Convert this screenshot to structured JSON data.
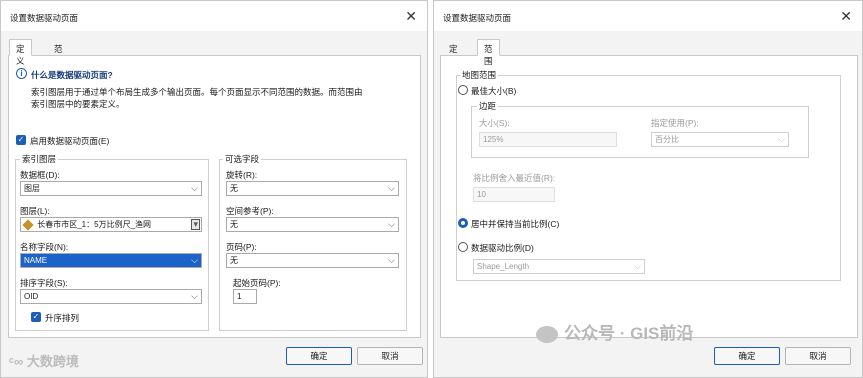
{
  "left_dialog": {
    "title": "设置数据驱动页面",
    "tabs": [
      "定义",
      "范围"
    ],
    "info": {
      "heading": "什么是数据驱动页面?",
      "line1": "索引图层用于通过单个布局生成多个输出页面。每个页面显示不同范围的数据。而范围由",
      "line2": "索引图层中的要素定义。"
    },
    "enable_checkbox_label": "启用数据驱动页面(E)",
    "index_layer_group": {
      "title": "索引图层",
      "data_frame_label": "数据框(D):",
      "data_frame_value": "图层",
      "layer_label": "图层(L):",
      "layer_value": "长春市市区_1：5万比例尺_渔网",
      "name_field_label": "名称字段(N):",
      "name_field_value": "NAME",
      "sort_field_label": "排序字段(S):",
      "sort_field_value": "OID",
      "ascending_label": "升序排列"
    },
    "optional_fields_group": {
      "title": "可选字段",
      "rotation_label": "旋转(R):",
      "rotation_value": "无",
      "spatial_ref_label": "空间参考(P):",
      "spatial_ref_value": "无",
      "page_number_label": "页码(P):",
      "page_number_value": "无",
      "start_page_label": "起始页码(P):",
      "start_page_value": "1"
    },
    "ok_label": "确定",
    "cancel_label": "取消"
  },
  "right_dialog": {
    "title": "设置数据驱动页面",
    "tabs": [
      "定义",
      "范围"
    ],
    "map_extent_group": {
      "title": "地图范围",
      "best_fit_label": "最佳大小(B)",
      "margin_group": {
        "title": "边距",
        "size_label": "大小(S):",
        "size_value": "125%",
        "use_label": "指定使用(P):",
        "use_value": "百分比"
      },
      "round_scale_label": "将比例舍入最近值(R):",
      "round_scale_value": "10",
      "center_keep_label": "居中并保持当前比例(C)",
      "data_driven_scale_label": "数据驱动比例(D)",
      "data_driven_scale_value": "Shape_Length"
    },
    "ok_label": "确定",
    "cancel_label": "取消"
  },
  "watermarks": {
    "left": "大数跨境",
    "right": "公众号 · GIS前沿"
  },
  "icons": {
    "close": "close-icon",
    "info": "info-icon",
    "dropdown": "chevron-down-icon",
    "layer": "layer-icon",
    "wechat": "wechat-icon"
  },
  "colors": {
    "accent": "#1b5eb8",
    "selection": "#1d62c8"
  }
}
